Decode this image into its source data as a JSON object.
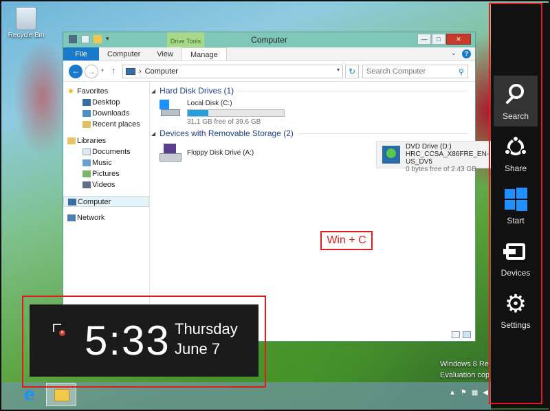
{
  "desktop": {
    "recycle_bin_label": "Recycle Bin",
    "watermark_line1": "Windows 8 Re",
    "watermark_line2": "Evaluation cop"
  },
  "window": {
    "title": "Computer",
    "drive_tools_label": "Drive Tools",
    "tabs": {
      "file": "File",
      "computer": "Computer",
      "view": "View",
      "manage": "Manage"
    },
    "address_text": "Computer",
    "search_placeholder": "Search Computer",
    "nav": {
      "favorites": "Favorites",
      "desktop": "Desktop",
      "downloads": "Downloads",
      "recent_places": "Recent places",
      "libraries": "Libraries",
      "documents": "Documents",
      "music": "Music",
      "pictures": "Pictures",
      "videos": "Videos",
      "computer": "Computer",
      "network": "Network"
    },
    "groups": {
      "hard_disk": "Hard Disk Drives (1)",
      "removable": "Devices with Removable Storage (2)"
    },
    "drives": {
      "local_name": "Local Disk (C:)",
      "local_free": "31.1 GB free of 39.6 GB",
      "local_used_fraction": 0.215,
      "floppy_name": "Floppy Disk Drive (A:)",
      "dvd_name": "DVD Drive (D:)",
      "dvd_label": "HRC_CCSA_X86FRE_EN-US_DV5",
      "dvd_free": "0 bytes free of 2.43 GB"
    }
  },
  "annotation": "Win + C",
  "clock": {
    "time": "5:33",
    "day": "Thursday",
    "date": "June 7"
  },
  "charms": {
    "search": "Search",
    "share": "Share",
    "start": "Start",
    "devices": "Devices",
    "settings": "Settings"
  },
  "colors": {
    "accent": "#1979ca",
    "annotation_red": "#e21b1b",
    "charms_bg": "#111111",
    "start_blue": "#1e90ff"
  }
}
